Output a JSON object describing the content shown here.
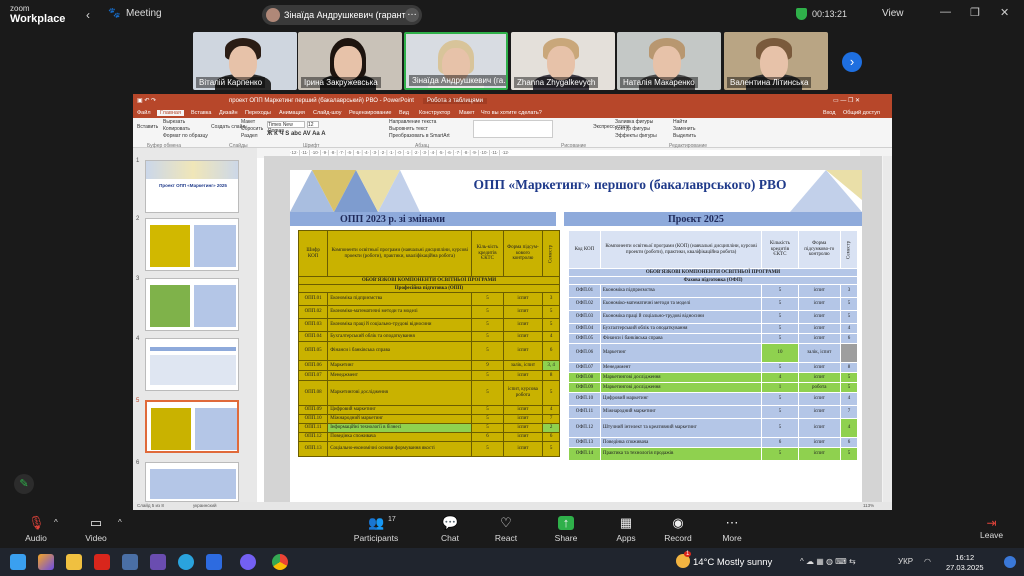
{
  "zoom": {
    "logo_top": "zoom",
    "logo_bottom": "Workplace",
    "meeting_label": "Meeting",
    "speaker_chip": "Зінаїда Андрушкевич (гарант С",
    "timer": "00:13:21",
    "view_label": "View"
  },
  "participants_strip": [
    {
      "name": "Віталій Карпенко"
    },
    {
      "name": "Ірина Закружевська"
    },
    {
      "name": "Зінаїда Андрушкевич (га..."
    },
    {
      "name": "Zhanna Zhygalkevych"
    },
    {
      "name": "Наталія Макаренко"
    },
    {
      "name": "Валентина Літинська"
    }
  ],
  "ppt": {
    "title_bar": "проект ОПП Маркетинг перший (бакалаврський) РВО - PowerPoint",
    "tab_work": "Робота з таблицями",
    "tabs": [
      "Файл",
      "Главная",
      "Вставка",
      "Дизайн",
      "Переходы",
      "Анимация",
      "Слайд-шоу",
      "Рецензирование",
      "Вид",
      "Конструктор",
      "Макет",
      "Что вы хотите сделать?"
    ],
    "share": "Общий доступ",
    "login": "Вход",
    "ribbon": {
      "paste": "Вставить",
      "cut": "Вырезать",
      "copy": "Копировать",
      "format": "Формат по образцу",
      "layout": "Макет",
      "reset": "Сбросить",
      "new_slide": "Создать слайд",
      "section": "Раздел",
      "font": "Times New Roman",
      "size": "12",
      "text_dir": "Направление текста",
      "align": "Выровнять текст",
      "smartart": "Преобразовать в SmartArt",
      "shapes_fill": "Заливка фигуры",
      "outline": "Контур фигуры",
      "effects": "Эффекты фигуры",
      "express": "Экспресс-стили",
      "find": "Найти",
      "replace": "Заменить",
      "select": "Выделить",
      "g_clip": "Буфер обмена",
      "g_slides": "Слайды",
      "g_font": "Шрифт",
      "g_para": "Абзац",
      "g_draw": "Рисование",
      "g_edit": "Редактирование"
    },
    "thumb_numbers": [
      "1",
      "2",
      "3",
      "4",
      "5",
      "6"
    ],
    "thumb1_title": "Проект ОПП «Маркетинг» 2025",
    "status_slide": "Слайд 5 из 8",
    "status_lang": "украинский",
    "status_zoom": "113%"
  },
  "slide": {
    "title": "ОПП «Маркетинг» першого (бакалаврського) РВО",
    "left_header": "ОПП 2023 р. зі змінами",
    "right_header": "Проєкт 2025",
    "left_cols": [
      "Шифр КОП",
      "Компоненти освітньої програми (навчальні дисципліни, курсові проекти (роботи), практики, кваліфікаційна робота)",
      "Кіль-кість кредитів ЄКТС",
      "Форма підсум-кового контролю",
      "Семестр"
    ],
    "left_sec1": "ОБОВ'ЯЗКОВІ КОМПОНЕНТИ ОСВІТНЬОЇ ПРОГРАМИ",
    "left_sec2": "Професійна підготовка (ОПП)",
    "left_rows": [
      [
        "ОПП.01",
        "Економіка підприємства",
        "5",
        "іспит",
        "3"
      ],
      [
        "ОПП.02",
        "Економіко-математичні методи та моделі",
        "5",
        "іспит",
        "5"
      ],
      [
        "ОПП.03",
        "Економіка праці й соціально-трудові відносини",
        "5",
        "іспит",
        "5"
      ],
      [
        "ОПП.04",
        "Бухгалтерський облік та оподаткування",
        "5",
        "іспит",
        "4"
      ],
      [
        "ОПП.05",
        "Фінанси і банківська справа",
        "5",
        "іспит",
        "6"
      ],
      [
        "ОПП.06",
        "Маркетинг",
        "9",
        "залік, іспит",
        "3, 4"
      ],
      [
        "ОПП.07",
        "Менеджмент",
        "5",
        "іспит",
        "8"
      ],
      [
        "ОПП.08",
        "Маркетингові дослідження",
        "5",
        "іспит, курсова робота",
        "5"
      ],
      [
        "ОПП.09",
        "Цифровий маркетинг",
        "5",
        "іспит",
        "4"
      ],
      [
        "ОПП.10",
        "Міжнародний маркетинг",
        "5",
        "іспит",
        "7"
      ],
      [
        "ОПП.11",
        "Інформаційні технології в бізнесі",
        "5",
        "іспит",
        "2"
      ],
      [
        "ОПП.12",
        "Поведінка споживача",
        "6",
        "іспит",
        "6"
      ],
      [
        "ОПП.13",
        "Соціально-економічні основи формування якості",
        "5",
        "іспит",
        "5"
      ]
    ],
    "right_cols": [
      "Код КОП",
      "Компоненти освітньої програми (КОП) (навчальні дисципліни, курсові проекти (роботи), практики, кваліфікаційна робота)",
      "Кількість кредитів ЄКТС",
      "Форма підсумково-го контролю",
      "Семестр"
    ],
    "right_sec1": "ОБОВ'ЯЗКОВІ КОМПОНЕНТИ ОСВІТНЬОЇ ПРОГРАМИ",
    "right_sec2": "Фахова підготовка (ОФП)",
    "right_rows": [
      [
        "ОФП.01",
        "Економіка підприємства",
        "5",
        "іспит",
        "3"
      ],
      [
        "ОФП.02",
        "Економіко-математичні методи та моделі",
        "5",
        "іспит",
        "5"
      ],
      [
        "ОФП.03",
        "Економіка праці й соціально-трудові відносини",
        "5",
        "іспит",
        "5"
      ],
      [
        "ОФП.04",
        "Бухгалтерський облік та оподаткування",
        "5",
        "іспит",
        "4"
      ],
      [
        "ОФП.05",
        "Фінанси і банківська справа",
        "5",
        "іспит",
        "6"
      ],
      [
        "ОФП.06",
        "Маркетинг",
        "10",
        "залік, іспит",
        ""
      ],
      [
        "ОФП.07",
        "Менеджмент",
        "5",
        "іспит",
        "8"
      ],
      [
        "ОФП.08",
        "Маркетингові дослідження",
        "4",
        "іспит",
        "5"
      ],
      [
        "ОФП.09",
        "Маркетингові дослідження",
        "1",
        "робота",
        "5"
      ],
      [
        "ОФП.10",
        "Цифровий маркетинг",
        "5",
        "іспит",
        "4"
      ],
      [
        "ОФП.11",
        "Міжнародний маркетинг",
        "5",
        "іспит",
        "7"
      ],
      [
        "ОФП.12",
        "Штучний інтелект та креативний маркетинг",
        "5",
        "іспит",
        "4"
      ],
      [
        "ОФП.13",
        "Поведінка споживача",
        "6",
        "іспит",
        "6"
      ],
      [
        "ОФП.14",
        "Практика та технологія продажів",
        "5",
        "іспит",
        "5"
      ]
    ]
  },
  "controls": {
    "audio": "Audio",
    "video": "Video",
    "participants": "Participants",
    "participants_count": "17",
    "chat": "Chat",
    "react": "React",
    "share": "Share",
    "apps": "Apps",
    "record": "Record",
    "more": "More",
    "leave": "Leave"
  },
  "taskbar": {
    "temp": "14°C",
    "weather": "Mostly sunny",
    "lang": "УКР",
    "time": "16:12",
    "date": "27.03.2025",
    "badge": "1"
  },
  "colors": {
    "ppt_red": "#b7472a",
    "left_table": "#c9b200",
    "right_table": "#b4c6e7",
    "highlight_green": "#8fd14f",
    "share_green": "#2fb04a"
  }
}
